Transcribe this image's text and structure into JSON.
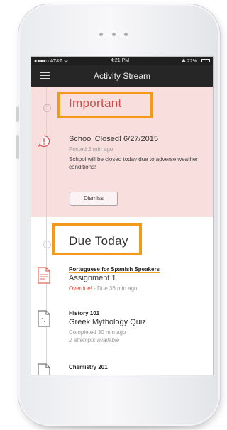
{
  "statusbar": {
    "carrier": "●●●●○ AT&T ᯤ",
    "time": "4:21 PM",
    "battery": "✱ 22%"
  },
  "nav": {
    "title": "Activity Stream"
  },
  "important": {
    "title": "Important",
    "alert_title": "School Closed! 6/27/2015",
    "alert_posted": "Posted 2 min ago",
    "alert_body": "School will be closed today due to adverse weather conditions!",
    "dismiss_label": "Dismiss"
  },
  "due": {
    "title": "Due Today",
    "items": [
      {
        "course": "Portuguese for Spanish Speakers",
        "title": "Assignment 1",
        "status_prefix": "Overdue!",
        "status_suffix": " - Due 36 min ago",
        "icon": "document-icon-red"
      },
      {
        "course": "History 101",
        "title": "Greek Mythology Quiz",
        "status": "Completed 30 min ago",
        "note": "2 attempts available",
        "icon": "quiz-document-icon"
      },
      {
        "course": "Chemistry 201",
        "icon": "document-icon"
      }
    ]
  },
  "colors": {
    "highlight": "#f49a1a",
    "important_bg": "#f9dede",
    "important_text": "#d24b4b",
    "overdue": "#e04b3c",
    "navbar": "#262626"
  }
}
